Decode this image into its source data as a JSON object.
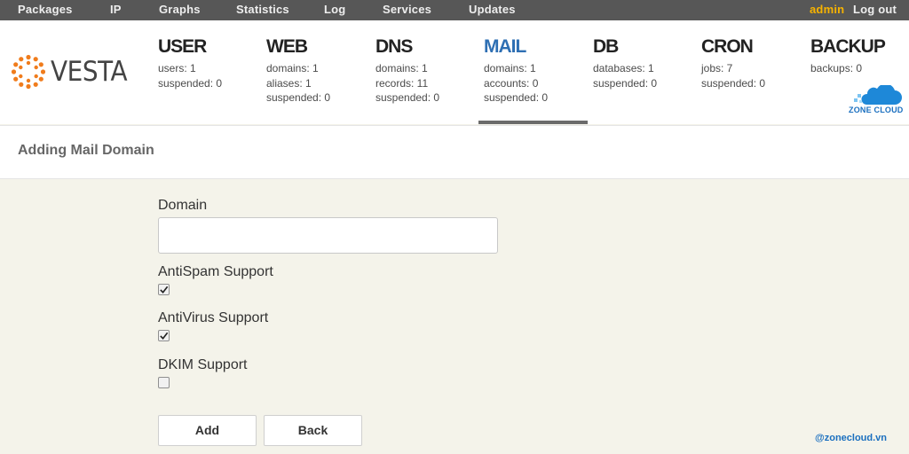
{
  "topnav": {
    "items": [
      "Packages",
      "IP",
      "Graphs",
      "Statistics",
      "Log",
      "Services",
      "Updates"
    ],
    "user": "admin",
    "logout": "Log out"
  },
  "logo": {
    "text": "VESTA"
  },
  "stats": [
    {
      "title": "USER",
      "lines": [
        "users: 1",
        "suspended: 0"
      ]
    },
    {
      "title": "WEB",
      "lines": [
        "domains: 1",
        "aliases: 1",
        "suspended: 0"
      ]
    },
    {
      "title": "DNS",
      "lines": [
        "domains: 1",
        "records: 11",
        "suspended: 0"
      ]
    },
    {
      "title": "MAIL",
      "lines": [
        "domains: 1",
        "accounts: 0",
        "suspended: 0"
      ],
      "active": true
    },
    {
      "title": "DB",
      "lines": [
        "databases: 1",
        "suspended: 0"
      ]
    },
    {
      "title": "CRON",
      "lines": [
        "jobs: 7",
        "suspended: 0"
      ]
    },
    {
      "title": "BACKUP",
      "lines": [
        "backups: 0"
      ]
    }
  ],
  "brand_badge": {
    "text": "ZONE CLOUD"
  },
  "page": {
    "title": "Adding Mail Domain"
  },
  "form": {
    "domain_label": "Domain",
    "domain_value": "",
    "antispam_label": "AntiSpam Support",
    "antispam_checked": true,
    "antivirus_label": "AntiVirus Support",
    "antivirus_checked": true,
    "dkim_label": "DKIM Support",
    "dkim_checked": false,
    "add_label": "Add",
    "back_label": "Back"
  },
  "watermark": "@zonecloud.vn",
  "colors": {
    "accent": "#2e6fb3",
    "user": "#f7b300",
    "topbar": "#575757",
    "logo": "#f07c1c"
  }
}
